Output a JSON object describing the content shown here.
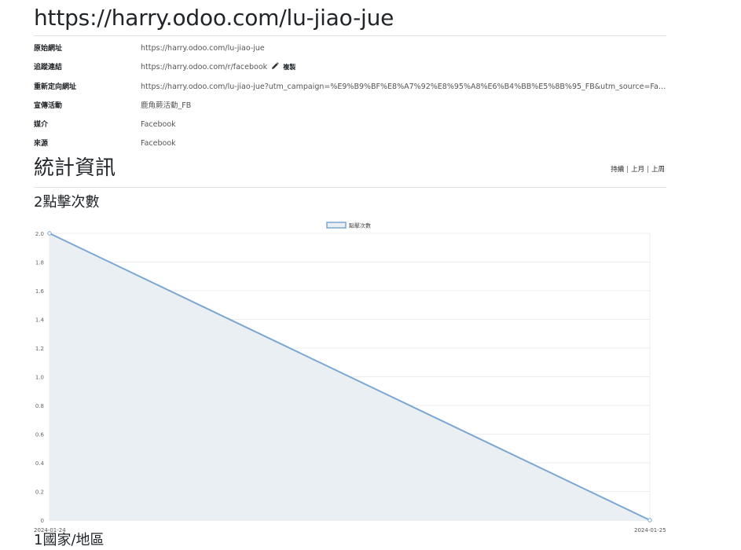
{
  "page": {
    "title": "https://harry.odoo.com/lu-jiao-jue"
  },
  "info": [
    {
      "label": "原始網址",
      "value": "https://harry.odoo.com/lu-jiao-jue"
    },
    {
      "label": "追蹤連結",
      "value": "https://harry.odoo.com/r/facebook",
      "action": "複製"
    },
    {
      "label": "重新定向網址",
      "value": "https://harry.odoo.com/lu-jiao-jue?utm_campaign=%E9%B9%BF%E8%A7%92%E8%95%A8%E6%B4%BB%E5%8B%95_FB&utm_source=Facebo…"
    },
    {
      "label": "宣傳活動",
      "value": "鹿角蕨活動_FB"
    },
    {
      "label": "媒介",
      "value": "Facebook"
    },
    {
      "label": "來源",
      "value": "Facebook"
    }
  ],
  "stats": {
    "title": "統計資訊",
    "periods": [
      "持續",
      "上月",
      "上周"
    ]
  },
  "chart_section": {
    "title": "2點擊次數",
    "next_title": "1國家/地區"
  },
  "icons": {
    "pencil": "pencil-icon"
  },
  "colors": {
    "line": "#7ba7d2",
    "fill": "#eaeff4"
  },
  "chart_data": {
    "type": "line",
    "x": [
      "2024-01-24",
      "2024-01-25"
    ],
    "series": [
      {
        "name": "點擊次數",
        "values": [
          2,
          0
        ]
      }
    ],
    "yticks": [
      "2.0",
      "1.8",
      "1.6",
      "1.4",
      "1.2",
      "1.0",
      "0.8",
      "0.6",
      "0.4",
      "0.2",
      "0"
    ],
    "ylim": [
      0,
      2
    ],
    "legend": "top-center",
    "grid": true,
    "fill": true
  }
}
